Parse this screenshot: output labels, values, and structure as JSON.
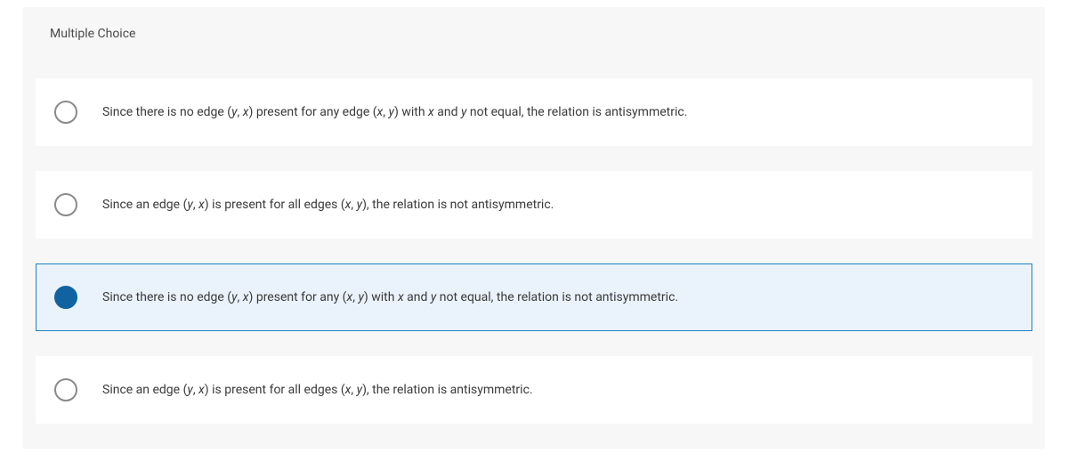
{
  "header": {
    "title": "Multiple Choice"
  },
  "options": [
    {
      "prefix": "Since there is no edge (",
      "v1": "y",
      "sep1": ", ",
      "v2": "x",
      "mid1": ") present for any edge (",
      "v3": "x",
      "sep2": ", ",
      "v4": "y",
      "mid2": ") with ",
      "v5": "x",
      "and": " and ",
      "v6": "y",
      "suffix": " not equal, the relation is antisymmetric.",
      "selected": false
    },
    {
      "prefix": "Since an edge (",
      "v1": "y",
      "sep1": ", ",
      "v2": "x",
      "mid1": ") is present for all edges (",
      "v3": "x",
      "sep2": ", ",
      "v4": "y",
      "mid2": "",
      "v5": "",
      "and": "",
      "v6": "",
      "suffix": "), the relation is not antisymmetric.",
      "selected": false
    },
    {
      "prefix": "Since there is no edge (",
      "v1": "y",
      "sep1": ", ",
      "v2": "x",
      "mid1": ") present for any (",
      "v3": "x",
      "sep2": ", ",
      "v4": "y",
      "mid2": ") with ",
      "v5": "x",
      "and": " and ",
      "v6": "y",
      "suffix": " not equal, the relation is not antisymmetric.",
      "selected": true
    },
    {
      "prefix": "Since an edge (",
      "v1": "y",
      "sep1": ", ",
      "v2": "x",
      "mid1": ") is present for all edges (",
      "v3": "x",
      "sep2": ", ",
      "v4": "y",
      "mid2": "",
      "v5": "",
      "and": "",
      "v6": "",
      "suffix": "), the relation is antisymmetric.",
      "selected": false
    }
  ]
}
